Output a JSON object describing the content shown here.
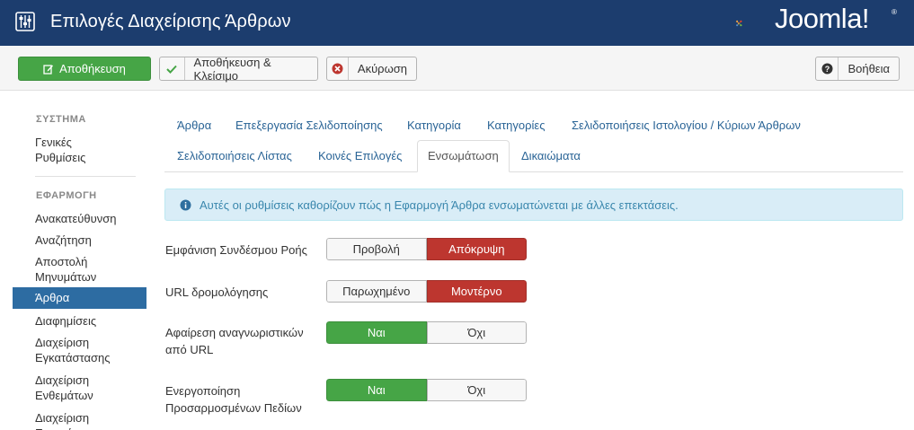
{
  "header": {
    "title": "Επιλογές Διαχείρισης Άρθρων",
    "logo_text": "Joomla!",
    "logo_reg": "®"
  },
  "toolbar": {
    "save_label": "Αποθήκευση",
    "save_close_label": "Αποθήκευση & Κλείσιμο",
    "cancel_label": "Ακύρωση",
    "help_label": "Βοήθεια"
  },
  "sidebar": {
    "system_heading": "ΣΥΣΤΗΜΑ",
    "system_items": [
      "Γενικές\nΡυθμίσεις"
    ],
    "app_heading": "ΕΦΑΡΜΟΓΗ",
    "items": [
      "Ανακατεύθυνση",
      "Αναζήτηση",
      "Αποστολή Μηνυμάτων",
      "Άρθρα",
      "Διαφημίσεις",
      "Διαχείριση Εγκατάστασης",
      "Διαχείριση Ενθεμάτων",
      "Διαχείριση Επεκτάσεων"
    ]
  },
  "tabs": [
    "Άρθρα",
    "Επεξεργασία Σελιδοποίησης",
    "Κατηγορία",
    "Κατηγορίες",
    "Σελιδοποιήσεις Ιστολογίου / Κύριων Άρθρων",
    "Σελιδοποιήσεις Λίστας",
    "Κοινές Επιλογές",
    "Ενσωμάτωση",
    "Δικαιώματα"
  ],
  "active_tab": "Ενσωμάτωση",
  "alert": {
    "text": "Αυτές οι ρυθμίσεις καθορίζουν πώς η Εφαρμογή Άρθρα ενσωματώνεται με άλλες επεκτάσεις."
  },
  "form": {
    "rows": [
      {
        "label": "Εμφάνιση Συνδέσμου Ροής",
        "options": [
          "Προβολή",
          "Απόκρυψη"
        ],
        "selected": 1
      },
      {
        "label": "URL δρομολόγησης",
        "options": [
          "Παρωχημένο",
          "Μοντέρνο"
        ],
        "selected": 1
      },
      {
        "label": "Αφαίρεση αναγνωριστικών από URL",
        "options": [
          "Ναι",
          "Όχι"
        ],
        "selected": 0
      },
      {
        "label": "Ενεργοποίηση Προσαρμοσμένων Πεδίων",
        "options": [
          "Ναι",
          "Όχι"
        ],
        "selected": 0
      }
    ]
  },
  "colors": {
    "header_bg": "#1c3d6e",
    "save_green": "#46a546",
    "danger_red": "#bd362f",
    "sidebar_active": "#2d6ca2",
    "link_blue": "#2a6496",
    "alert_bg": "#d9edf7"
  }
}
